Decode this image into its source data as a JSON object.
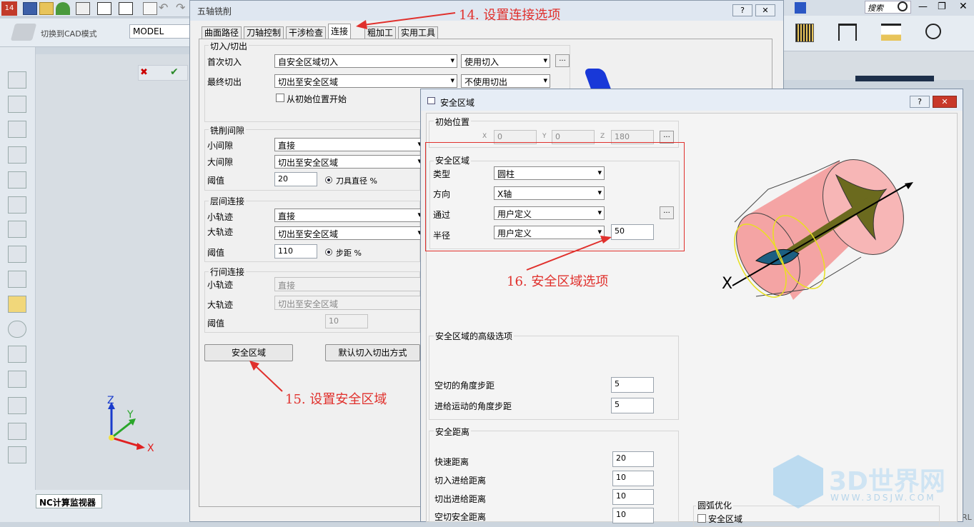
{
  "app": {
    "quick_title": "切换到CAD模式",
    "model_field": "MODEL",
    "search_label": "搜索",
    "nc_monitor": "NC计算监视器",
    "axes": {
      "x": "X",
      "y": "Y",
      "z": "Z"
    },
    "partial_right": "RL"
  },
  "main_dialog": {
    "title": "五轴铣削",
    "help_glyph": "?",
    "close_glyph": "✕",
    "tabs": [
      "曲面路径",
      "刀轴控制",
      "干涉检查",
      "连接",
      "粗加工",
      "实用工具"
    ],
    "inout": {
      "title": "切入/切出",
      "first_in_label": "首次切入",
      "first_in_value": "自安全区域切入",
      "first_in_use": "使用切入",
      "last_out_label": "最终切出",
      "last_out_value": "切出至安全区域",
      "last_out_use": "不使用切出",
      "from_init_label": "从初始位置开始",
      "dots": "..."
    },
    "gap": {
      "title": "铣削间隙",
      "small_label": "小间隙",
      "small_value": "直接",
      "large_label": "大间隙",
      "large_value": "切出至安全区域",
      "threshold_label": "阈值",
      "threshold_value": "20",
      "threshold_unit": "刀具直径 %"
    },
    "layer": {
      "title": "层间连接",
      "small_label": "小轨迹",
      "small_value": "直接",
      "large_label": "大轨迹",
      "large_value": "切出至安全区域",
      "threshold_label": "阈值",
      "threshold_value": "110",
      "threshold_unit": "步距 %"
    },
    "row": {
      "title": "行间连接",
      "small_label": "小轨迹",
      "small_value": "直接",
      "large_label": "大轨迹",
      "large_value": "切出至安全区域",
      "threshold_label": "阈值",
      "threshold_value": "10"
    },
    "safe_btn": "安全区域",
    "default_btn": "默认切入切出方式"
  },
  "safe_dialog": {
    "title": "安全区域",
    "help_glyph": "?",
    "close_glyph": "✕",
    "init": {
      "title": "初始位置",
      "x_label": "X",
      "x": "0",
      "y_label": "Y",
      "y": "0",
      "z_label": "Z",
      "z": "180",
      "dots": "..."
    },
    "zone": {
      "title": "安全区域",
      "type_label": "类型",
      "type_value": "圆柱",
      "dir_label": "方向",
      "dir_value": "X轴",
      "pass_label": "通过",
      "pass_value": "用户定义",
      "radius_label": "半径",
      "radius_type": "用户定义",
      "radius_value": "50",
      "dots": "..."
    },
    "adv": {
      "title": "安全区域的高级选项",
      "air_label": "空切的角度步距",
      "air_value": "5",
      "feed_label": "进给运动的角度步距",
      "feed_value": "5"
    },
    "dist": {
      "title": "安全距离",
      "rapid_label": "快速距离",
      "rapid_value": "20",
      "in_label": "切入进给距离",
      "in_value": "10",
      "out_label": "切出进给距离",
      "out_value": "10",
      "air_label": "空切安全距离",
      "air_value": "10"
    },
    "arc": {
      "title": "圆弧优化",
      "check_label": "安全区域"
    },
    "preview_x": "X"
  },
  "annotations": {
    "a14": "14. 设置连接选项",
    "a15": "15. 设置安全区域",
    "a16": "16. 安全区域选项"
  },
  "watermark": {
    "name": "3D世界网",
    "url": "WWW.3DSJW.COM"
  },
  "colors": {
    "annotation": "#e0302c",
    "cylinder": "#f4a4a4",
    "tool": "#6b6a1e",
    "title_blue": "#2b579a"
  }
}
